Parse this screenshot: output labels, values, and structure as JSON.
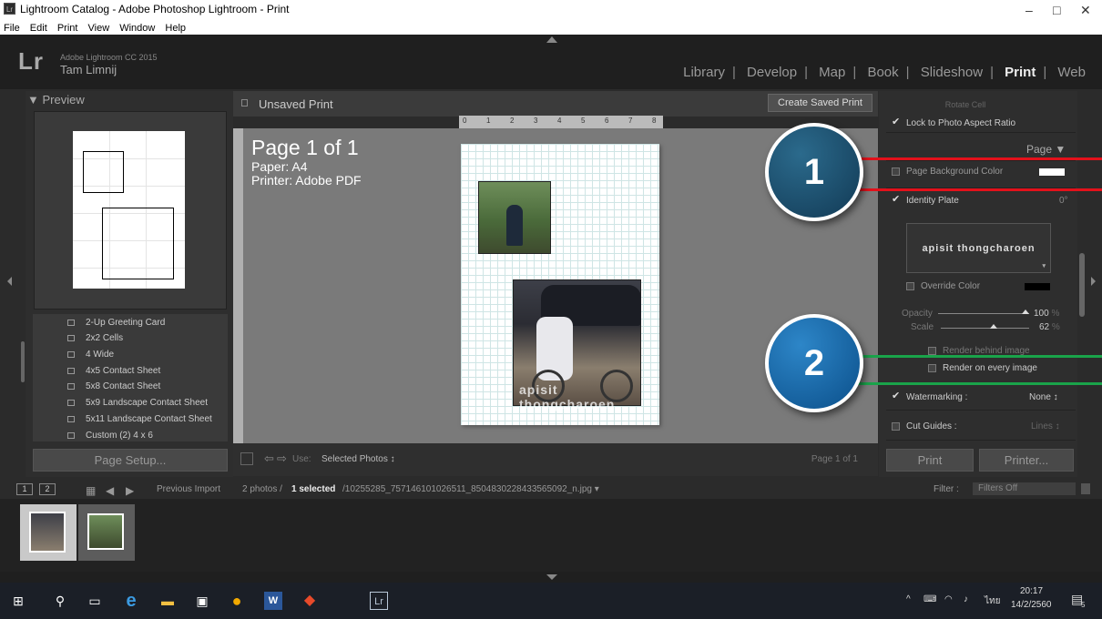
{
  "window": {
    "app_icon_label": "Lr",
    "title": "Lightroom Catalog - Adobe Photoshop Lightroom - Print",
    "minimize": "–",
    "restore": "□",
    "close": "✕"
  },
  "menu": [
    "File",
    "Edit",
    "Print",
    "View",
    "Window",
    "Help"
  ],
  "identity": {
    "logo": "Lr",
    "product": "Adobe Lightroom CC 2015",
    "user": "Tam Limnij"
  },
  "modules": {
    "items": [
      "Library",
      "Develop",
      "Map",
      "Book",
      "Slideshow",
      "Print",
      "Web"
    ],
    "separator": "|",
    "active": "Print"
  },
  "left_panel": {
    "preview_title": "▼ Preview",
    "templates": [
      "2-Up Greeting Card",
      "2x2 Cells",
      "4 Wide",
      "4x5 Contact Sheet",
      "5x8 Contact Sheet",
      "5x9 Landscape Contact Sheet",
      "5x11 Landscape Contact Sheet",
      "Custom (2) 4 x 6"
    ],
    "page_setup_button": "Page Setup..."
  },
  "center": {
    "title": "Unsaved Print",
    "create_saved_print": "Create Saved Print",
    "page_label": "Page 1 of 1",
    "paper": "Paper:  A4",
    "printer": "Printer:  Adobe PDF",
    "ruler_ticks": [
      "0",
      "1",
      "2",
      "3",
      "4",
      "5",
      "6",
      "7",
      "8"
    ],
    "watermark_text": "apisit thongcharoen",
    "use_label": "Use:",
    "use_value": "Selected Photos ↕",
    "footer_page": "Page 1 of 1"
  },
  "right_panel": {
    "rotate_cell": "Rotate Cell",
    "lock_aspect": "Lock to Photo Aspect Ratio",
    "section_page": "Page ▼",
    "page_background_color": "Page Background Color",
    "identity_plate": "Identity Plate",
    "identity_angle": "0°",
    "identity_plate_text": "apisit thongcharoen",
    "identity_dropdown": "▾",
    "override_color": "Override Color",
    "opacity_label": "Opacity",
    "opacity_value": "100",
    "scale_label": "Scale",
    "scale_value": "62",
    "percent": "%",
    "render_behind": "Render behind image",
    "render_every": "Render on every image",
    "watermarking_label": "Watermarking :",
    "watermarking_value": "None ↕",
    "cut_guides_label": "Cut Guides :",
    "cut_guides_value": "Lines ↕",
    "print_button": "Print",
    "printer_button": "Printer..."
  },
  "filmstrip": {
    "page1": "1",
    "page2": "2",
    "source": "Previous Import",
    "count_prefix": "2 photos /",
    "selected": "1 selected",
    "filename": "/10255285_757146101026511_8504830228433565092_n.jpg ▾",
    "filter_label": "Filter :",
    "filter_value": "Filters Off"
  },
  "taskbar": {
    "time": "20:17",
    "date": "14/2/2560",
    "lang": "ไทย",
    "notif_count": "5",
    "lr_label": "Lr"
  },
  "annotations": [
    {
      "number": "1",
      "color": "#1a4a6a",
      "line_color": "#e3111b"
    },
    {
      "number": "2",
      "color": "#0f5fa0",
      "line_color": "#1aa34a"
    }
  ],
  "icons": [
    "windows-start-icon",
    "search-icon",
    "task-view-icon",
    "edge-icon",
    "file-explorer-icon",
    "store-icon",
    "chrome-icon",
    "word-icon",
    "app-icon",
    "lightroom-icon"
  ]
}
